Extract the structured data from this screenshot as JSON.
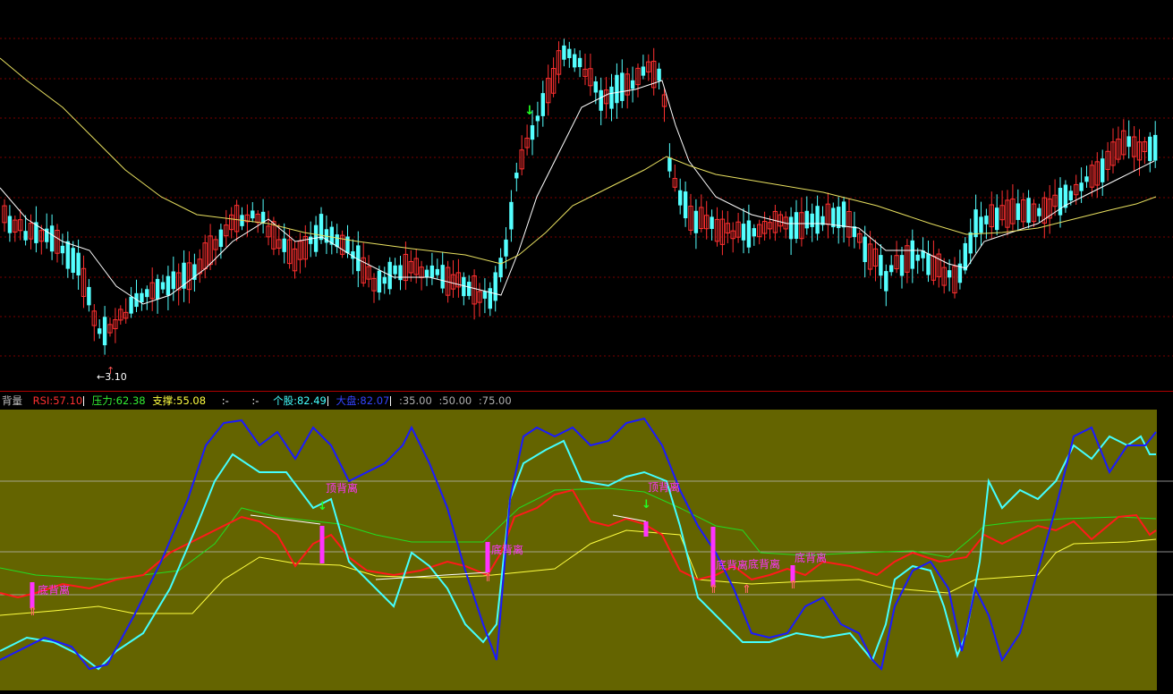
{
  "colors": {
    "background": "#000000",
    "grid_dotted": "#7a0000",
    "candle_up": "#ff3030",
    "candle_down": "#54ffff",
    "ma_short": "#ffffff",
    "ma_long": "#e8e060",
    "sub_bg": "#646400",
    "rsi": "#ff1a1a",
    "pressure": "#22dd22",
    "support": "#ffff40",
    "stock": "#44ffff",
    "market": "#1a1aff",
    "signal": "#ff33ff"
  },
  "main": {
    "low_marker_label": "←3.10"
  },
  "info_bar": {
    "indicator_name": "背量",
    "rsi": "RSI:57.10",
    "pressure": "压力:62.38",
    "support": "支撑:55.08",
    "blank1": ":-",
    "blank2": ":-",
    "stock": "个股:82.49",
    "market": "大盘:82.07",
    "level35": ":35.00",
    "level50": ":50.00",
    "level75": ":75.00"
  },
  "sub": {
    "signal_labels": [
      {
        "text": "底背离",
        "kind": "bottom"
      },
      {
        "text": "顶背离",
        "kind": "top"
      },
      {
        "text": "底背离",
        "kind": "bottom"
      },
      {
        "text": "顶背离",
        "kind": "top"
      },
      {
        "text": "底背离",
        "kind": "bottom"
      },
      {
        "text": "底背离",
        "kind": "bottom"
      },
      {
        "text": "底背离",
        "kind": "bottom"
      }
    ]
  }
}
